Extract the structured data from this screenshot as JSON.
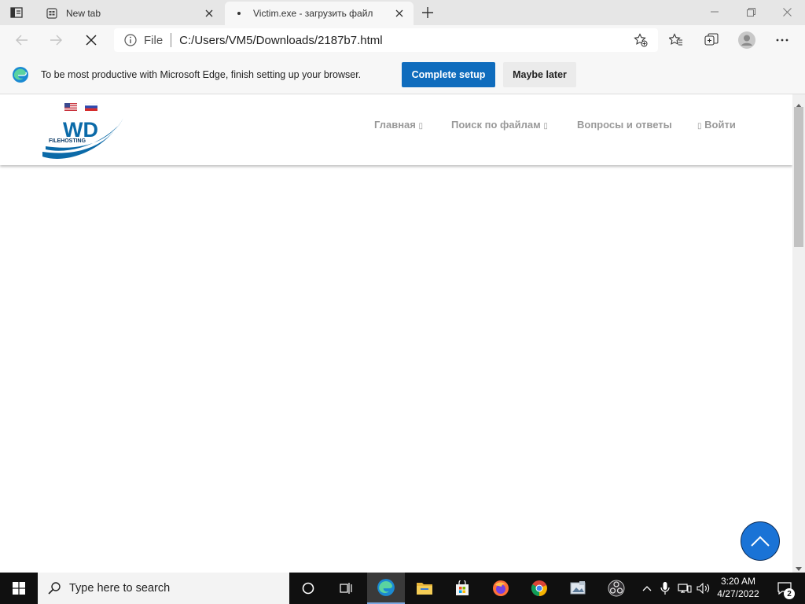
{
  "browser": {
    "tabs": [
      {
        "title": "New tab"
      },
      {
        "title": "Victim.exe - загрузить файл"
      }
    ],
    "address": {
      "scheme": "File",
      "url": "C:/Users/VM5/Downloads/2187b7.html"
    },
    "infobar": {
      "message": "To be most productive with Microsoft Edge, finish setting up your browser.",
      "complete_label": "Complete setup",
      "later_label": "Maybe later"
    }
  },
  "site": {
    "logo_text": "WD",
    "logo_subtext": "FILEHOSTING",
    "menu": {
      "home": "Главная",
      "search": "Поиск по файлам",
      "faq": "Вопросы и ответы",
      "login": "Войти"
    }
  },
  "taskbar": {
    "search_placeholder": "Type here to search",
    "time": "3:20 AM",
    "date": "4/27/2022",
    "notification_count": "2",
    "pinned": [
      "task-view-icon",
      "edge-icon",
      "file-explorer-icon",
      "store-icon",
      "firefox-icon",
      "chrome-icon",
      "photo-app-icon",
      "obs-icon"
    ]
  },
  "colors": {
    "accent": "#0f6cbd",
    "scroll_top_button": "#1a73d6",
    "logo_blue": "#0b6aa8",
    "menu_text": "#999999"
  }
}
